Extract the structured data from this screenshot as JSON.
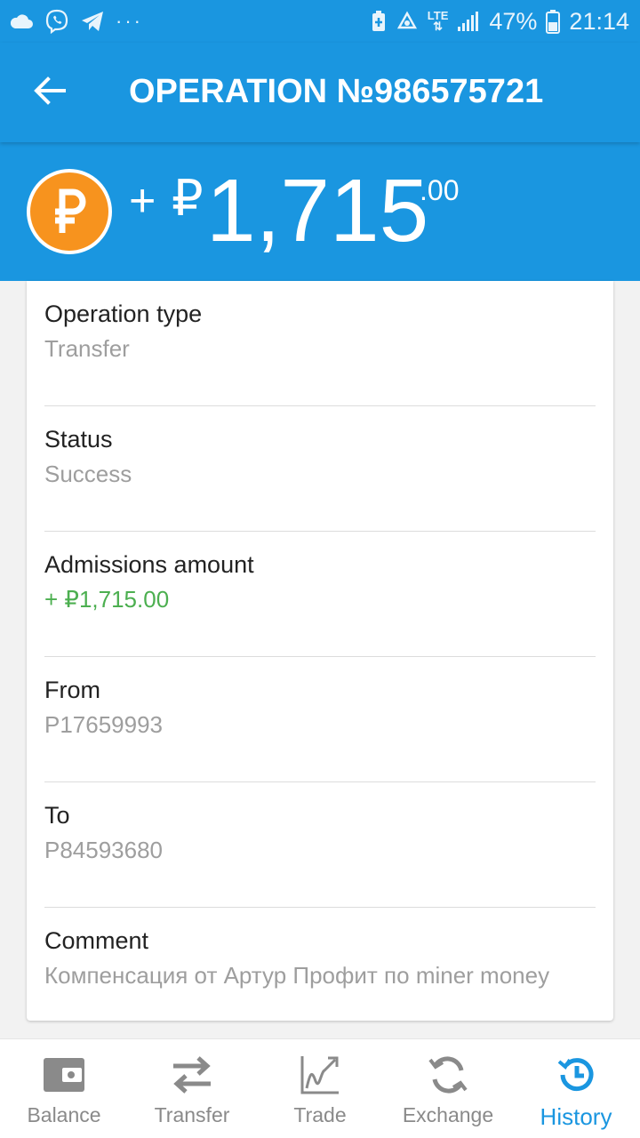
{
  "status_bar": {
    "battery_percent": "47%",
    "time": "21:14",
    "network": "LTE"
  },
  "header": {
    "title": "OPERATION №986575721",
    "back_icon": "arrow-left-icon"
  },
  "amount": {
    "sign": "+",
    "currency_symbol": "₽",
    "integer": "1,715",
    "cents": ".00",
    "coin_color": "#f7931e"
  },
  "details": [
    {
      "label": "Operation type",
      "value": "Transfer"
    },
    {
      "label": "Status",
      "value": "Success"
    },
    {
      "label": "Admissions amount",
      "value": "+ ₽1,715.00"
    },
    {
      "label": "From",
      "value": "P17659993"
    },
    {
      "label": "To",
      "value": "P84593680"
    },
    {
      "label": "Comment",
      "value": "Компенсация от Артур Профит по miner money"
    }
  ],
  "nav": [
    {
      "label": "Balance",
      "icon": "wallet-icon",
      "active": false
    },
    {
      "label": "Transfer",
      "icon": "transfer-arrows-icon",
      "active": false
    },
    {
      "label": "Trade",
      "icon": "trade-chart-icon",
      "active": false
    },
    {
      "label": "Exchange",
      "icon": "exchange-refresh-icon",
      "active": false
    },
    {
      "label": "History",
      "icon": "history-clock-icon",
      "active": true
    }
  ],
  "colors": {
    "primary": "#1a96e0",
    "positive": "#4caf50",
    "muted_text": "#9e9e9e"
  }
}
